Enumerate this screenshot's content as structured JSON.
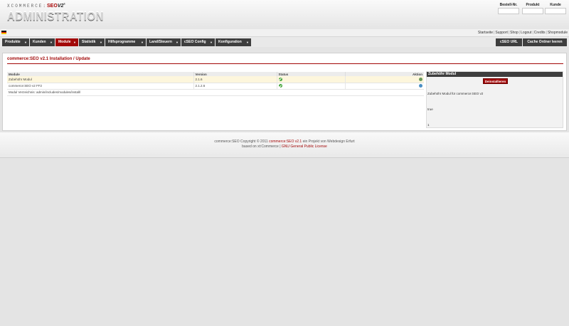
{
  "logo": {
    "tagline_prefix": "XCOMMERCE:",
    "tagline_seo": "SEO",
    "tagline_v2": "V2",
    "tagline_reg": "®",
    "title": "ADMINISTRATION"
  },
  "quicksearch": [
    {
      "label": "Bestell-Nr.",
      "value": ""
    },
    {
      "label": "Produkt",
      "value": ""
    },
    {
      "label": "Kunde",
      "value": ""
    }
  ],
  "toplinks": [
    "Startseite",
    "Support",
    "Shop",
    "Logout",
    "Credits",
    "Shopmodule"
  ],
  "toplinks_separator": "|",
  "nav": {
    "items": [
      {
        "label": "Produkte",
        "caret": "▼"
      },
      {
        "label": "Kunden",
        "caret": "▼"
      },
      {
        "label": "Module",
        "caret": "▼",
        "active": true
      },
      {
        "label": "Statistik",
        "caret": "▼"
      },
      {
        "label": "Hilfsprogramme",
        "caret": "▼"
      },
      {
        "label": "Land/Steuern",
        "caret": "▼"
      },
      {
        "label": "cSEO Config",
        "caret": "▼"
      },
      {
        "label": "Konfiguration",
        "caret": "▼"
      }
    ],
    "right": [
      "cSEO URL",
      "Cache Ordner leeren"
    ]
  },
  "page": {
    "title": "commerce:SEO v2.1 Installation / Update",
    "table": {
      "headers": [
        "Module",
        "Version",
        "Status",
        "Aktion"
      ],
      "rows": [
        {
          "module": "Zubehöhr Modul",
          "version": "2.1.6",
          "status": "ok-icon",
          "action": "arrow-right-icon",
          "selected": true
        },
        {
          "module": "commerce:SEO v2 FF2",
          "version": "2.1.2.6",
          "status": "ok-icon",
          "action": "info-icon",
          "selected": false
        }
      ],
      "dir_label": "Modul Verzeichnis: admin/includes/modules/install/"
    },
    "sidebox": {
      "title": "Zubehöhr Modul",
      "button": "Deinstallieren",
      "description": "Zubehöhr Modul für commerce:SEO v2",
      "value1": "true",
      "value2": "1"
    }
  },
  "footer": {
    "line1_a": "commerce:SEO Copyright © 2011",
    "line1_b": "commerce:SEO v2.1",
    "line1_c": "ein Projekt von Webdesign Erfurt",
    "line2_a": "based on xt:Commerce |",
    "line2_b": "GNU General Public License"
  },
  "colors": {
    "accent": "#a20808",
    "nav": "#3e3e3e",
    "status_ok": "#45a53a"
  }
}
